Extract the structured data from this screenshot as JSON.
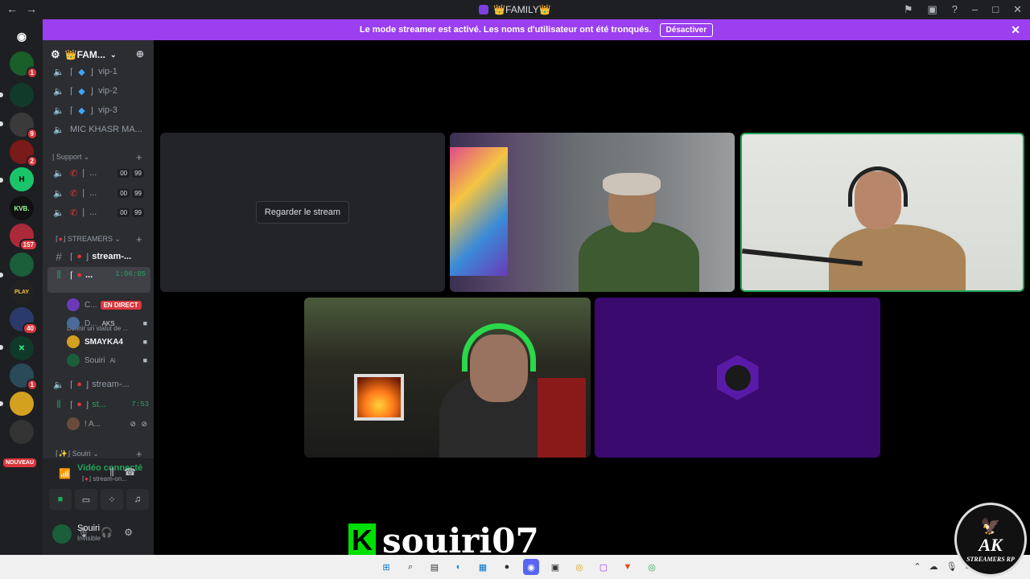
{
  "titlebar": {
    "title": "👑FAMILY👑",
    "back": "←",
    "forward": "→"
  },
  "banner": {
    "text": "Le mode streamer est activé. Les noms d'utilisateur ont été tronqués.",
    "button": "Désactiver"
  },
  "server_rail": {
    "badges": [
      "1",
      "9",
      "2",
      "157",
      "40",
      "1"
    ],
    "new_label": "NOUVEAU",
    "kvb": "KVB."
  },
  "server_header": {
    "name": "👑FAM..."
  },
  "channels": {
    "vip": [
      "vip-1",
      "vip-2",
      "vip-3"
    ],
    "mic": "MIC KHASR MA...",
    "support_category": "Support",
    "support_items": [
      {
        "label": "...",
        "a": "00",
        "b": "99"
      },
      {
        "label": "...",
        "a": "00",
        "b": "99"
      },
      {
        "label": "...",
        "a": "00",
        "b": "99"
      }
    ],
    "streamers_category": "STREAMERS",
    "text_channel": "stream-...",
    "active_voice": {
      "label": "...",
      "timer": "1:06:05",
      "status": "Définir un statut de ..."
    },
    "users": [
      {
        "name": "C...",
        "tag": "EN DIRECT",
        "color": "#6c3ab8"
      },
      {
        "name": "D...",
        "tag": "AKS",
        "color": "#4a6a9a"
      },
      {
        "name": "SMAYKA4",
        "tag": "",
        "color": "#d4a020"
      },
      {
        "name": "Souiri",
        "tag": "Ai",
        "color": "#1a5e3a"
      }
    ],
    "voice2": "stream-...",
    "voice3": {
      "label": "st...",
      "timer": "7:53"
    },
    "voice3_user": "! A...",
    "souiri_category": "Souiri"
  },
  "voice_panel": {
    "status": "Vidéo connecté",
    "channel": "stream-on..."
  },
  "user_panel": {
    "name": "Souiri",
    "status": "Invisible"
  },
  "stage": {
    "watch_button": "Regarder le stream"
  },
  "overlay": {
    "k": "K",
    "handle": "souiri07"
  },
  "badge": {
    "ak": "AK",
    "sub": "STREAMERS RP"
  },
  "colors": {
    "accent": "#9b3ff0",
    "green": "#23a55a",
    "live": "#da373c"
  }
}
